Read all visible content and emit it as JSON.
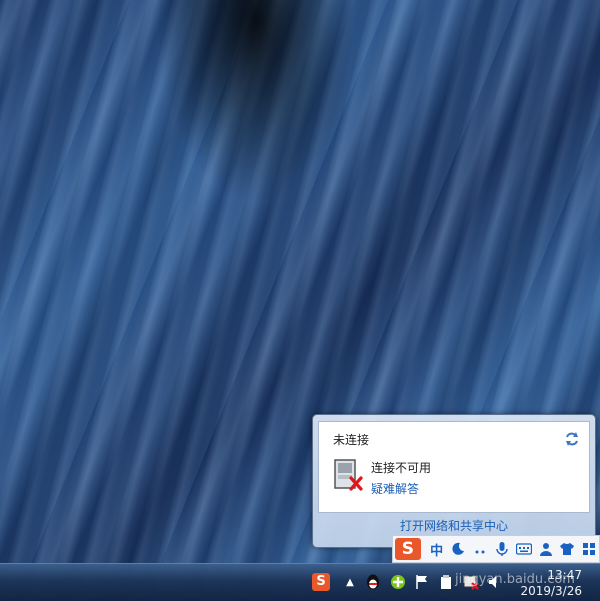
{
  "popup": {
    "title": "未连接",
    "status_text": "连接不可用",
    "troubleshoot_link": "疑难解答",
    "open_center_link": "打开网络和共享中心"
  },
  "ime_bar": {
    "logo": "S",
    "mode": "中",
    "items": [
      "moon-icon",
      "punctuation-icon",
      "microphone-icon",
      "keyboard-icon",
      "user-icon",
      "skin-icon",
      "grid-icon"
    ]
  },
  "taskbar": {
    "tray_arrow": "▲",
    "clock_time": "13:47",
    "clock_date": "2019/3/26"
  },
  "watermark": "jingyan.baidu.com"
}
